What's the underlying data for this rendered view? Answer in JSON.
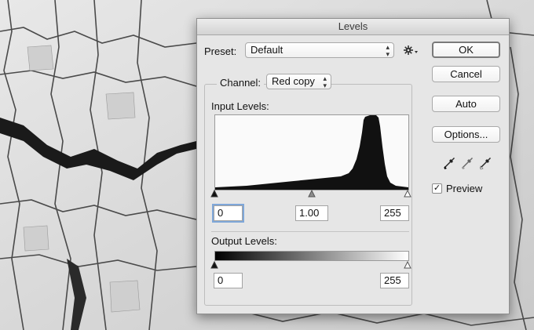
{
  "window": {
    "title": "Levels"
  },
  "preset": {
    "label": "Preset:",
    "value": "Default"
  },
  "channel": {
    "label": "Channel:",
    "value": "Red copy"
  },
  "input_levels": {
    "label": "Input Levels:",
    "black": "0",
    "gamma": "1.00",
    "white": "255"
  },
  "output_levels": {
    "label": "Output Levels:",
    "black": "0",
    "white": "255"
  },
  "buttons": {
    "ok": "OK",
    "cancel": "Cancel",
    "auto": "Auto",
    "options": "Options..."
  },
  "preview": {
    "label": "Preview",
    "checked": true
  },
  "icons": {
    "gear": "gear-icon",
    "eyedroppers": [
      "black-point-eyedropper-icon",
      "gray-point-eyedropper-icon",
      "white-point-eyedropper-icon"
    ]
  }
}
